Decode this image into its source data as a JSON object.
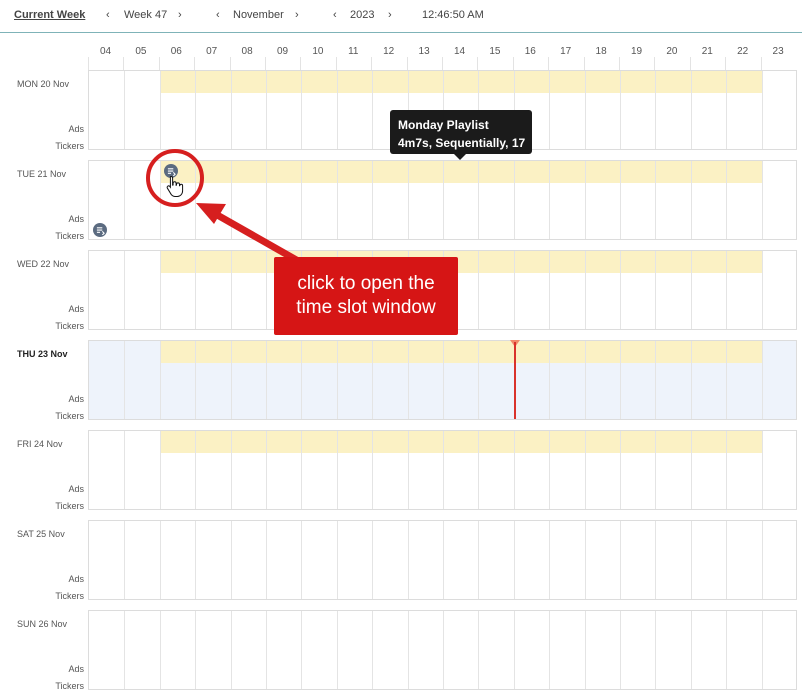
{
  "toolbar": {
    "current_week": "Current Week",
    "week_label": "Week 47",
    "month_label": "November",
    "year_label": "2023",
    "time": "12:46:50 AM"
  },
  "hours": [
    "04",
    "05",
    "06",
    "07",
    "08",
    "09",
    "10",
    "11",
    "12",
    "13",
    "14",
    "15",
    "16",
    "17",
    "18",
    "19",
    "20",
    "21",
    "22",
    "23"
  ],
  "days": [
    {
      "label": "MON 20 Nov",
      "ads": "Ads",
      "tickers": "Tickers"
    },
    {
      "label": "TUE 21 Nov",
      "ads": "Ads",
      "tickers": "Tickers"
    },
    {
      "label": "WED 22 Nov",
      "ads": "Ads",
      "tickers": "Tickers"
    },
    {
      "label": "THU 23 Nov",
      "ads": "Ads",
      "tickers": "Tickers"
    },
    {
      "label": "FRI 24 Nov",
      "ads": "Ads",
      "tickers": "Tickers"
    },
    {
      "label": "SAT 25 Nov",
      "ads": "Ads",
      "tickers": "Tickers"
    },
    {
      "label": "SUN 26 Nov",
      "ads": "Ads",
      "tickers": "Tickers"
    }
  ],
  "tooltip": {
    "line1": "Monday Playlist",
    "line2": "4m7s, Sequentially, 17"
  },
  "callout": {
    "text": "click to open the time slot window"
  },
  "colors": {
    "band": "#fbf1c4",
    "now_marker": "#d9322b",
    "annotation": "#d61f1f",
    "today_bg": "#eef3fb"
  }
}
